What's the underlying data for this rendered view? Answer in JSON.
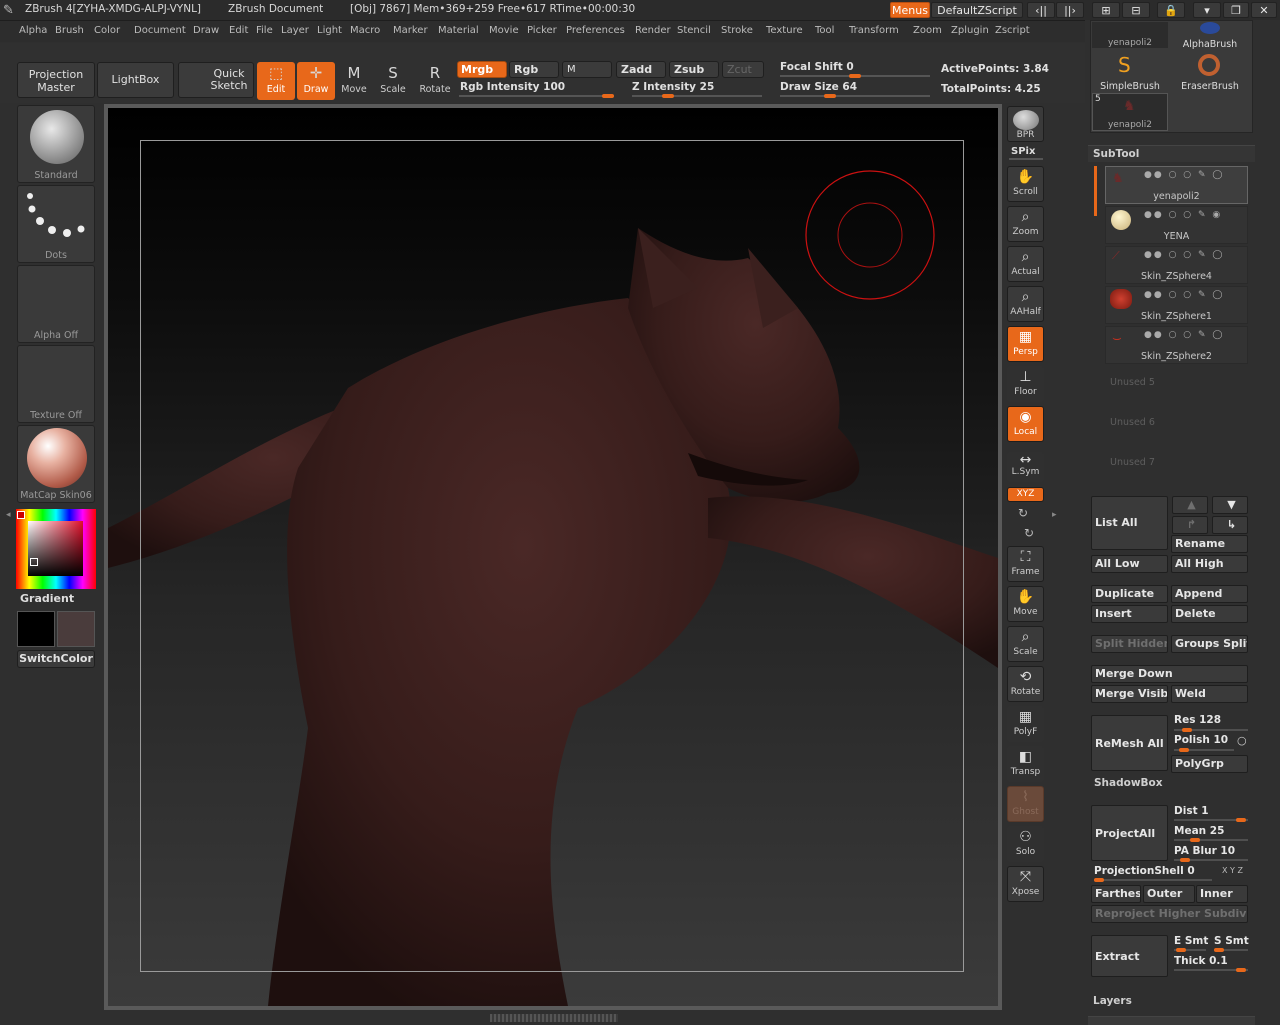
{
  "titlebar": {
    "app": "ZBrush 4[ZYHA-XMDG-ALPJ-VYNL]",
    "doc": "ZBrush Document",
    "stats": "[Obj] 7867]  Mem•369+259  Free•617  RTime•00:00:30",
    "menus_btn": "Menus",
    "script_btn": "DefaultZScript"
  },
  "menu": [
    "Alpha",
    "Brush",
    "Color",
    "Document",
    "Draw",
    "Edit",
    "File",
    "Layer",
    "Light",
    "Macro",
    "Marker",
    "Material",
    "Movie",
    "Picker",
    "Preferences",
    "Render",
    "Stencil",
    "Stroke",
    "Texture",
    "Tool",
    "Transform",
    "Zoom",
    "Zplugin",
    "Zscript"
  ],
  "shelf": {
    "projection_master": "Projection Master",
    "lightbox": "LightBox",
    "quick_sketch": "Quick Sketch",
    "edit": "Edit",
    "draw": "Draw",
    "move": "Move",
    "scale": "Scale",
    "rotate": "Rotate",
    "mrgb": "Mrgb",
    "rgb": "Rgb",
    "m": "M",
    "zadd": "Zadd",
    "zsub": "Zsub",
    "zcut": "Zcut",
    "rgb_intensity": "Rgb Intensity 100",
    "z_intensity": "Z Intensity 25",
    "focal_shift": "Focal Shift 0",
    "draw_size": "Draw Size 64",
    "active_points": "ActivePoints: 3.84",
    "total_points": "TotalPoints: 4.25",
    "rgb_intensity_value": 100,
    "z_intensity_value": 25,
    "focal_shift_value": 0,
    "draw_size_value": 64
  },
  "left_tray": {
    "brush": "Standard",
    "stroke": "Dots",
    "alpha": "Alpha Off",
    "texture": "Texture Off",
    "material": "MatCap Skin06",
    "gradient": "Gradient",
    "switch_color": "SwitchColor"
  },
  "canvas_toolbar": {
    "bpr": "BPR",
    "spix": "SPix",
    "scroll": "Scroll",
    "zoom": "Zoom",
    "actual": "Actual",
    "aahalf": "AAHalf",
    "persp": "Persp",
    "floor": "Floor",
    "local": "Local",
    "lsym": "L.Sym",
    "xyz": "XYZ",
    "frame": "Frame",
    "move": "Move",
    "scale": "Scale",
    "rotate": "Rotate",
    "polyf": "PolyF",
    "transp": "Transp",
    "ghost": "Ghost",
    "solo": "Solo",
    "xpose": "Xpose"
  },
  "tool_palette": {
    "thumb1": "yenapoli2",
    "thumb2": "AlphaBrush",
    "thumb3": "SimpleBrush",
    "thumb4": "EraserBrush",
    "thumb5": "yenapoli2",
    "thumb5_badge": "5"
  },
  "subtool": {
    "header": "SubTool",
    "items": [
      "yenapoli2",
      "YENA",
      "Skin_ZSphere4",
      "Skin_ZSphere1",
      "Skin_ZSphere2"
    ],
    "unused": [
      "Unused 5",
      "Unused 6",
      "Unused 7"
    ],
    "list_all": "List All",
    "rename": "Rename",
    "all_low": "All Low",
    "all_high": "All High",
    "duplicate": "Duplicate",
    "append": "Append",
    "insert": "Insert",
    "delete": "Delete",
    "split_hidden": "Split Hidden",
    "groups_split": "Groups Split",
    "merge_down": "Merge Down",
    "merge_visible": "Merge Visible",
    "weld": "Weld",
    "remesh_all": "ReMesh All",
    "res": "Res 128",
    "polish": "Polish 10",
    "polygrp": "PolyGrp",
    "shadowbox": "ShadowBox",
    "project_all": "ProjectAll",
    "dist": "Dist 1",
    "mean": "Mean 25",
    "pa_blur": "PA Blur 10",
    "projection_shell": "ProjectionShell 0",
    "farthest": "Farthest",
    "outer": "Outer",
    "inner": "Inner",
    "reproject": "Reproject Higher Subdiv",
    "extract": "Extract",
    "e_smt": "E Smt",
    "s_smt": "S Smt",
    "thick": "Thick 0.1",
    "layers": "Layers",
    "res_value": 128,
    "polish_value": 10,
    "dist_value": 1,
    "mean_value": 25,
    "pa_blur_value": 10,
    "projection_shell_value": 0,
    "thick_value": 0.1
  },
  "colors": {
    "accent": "#e8681a",
    "skin": "#3a1f1d",
    "brush_ring": "#cc1111"
  }
}
